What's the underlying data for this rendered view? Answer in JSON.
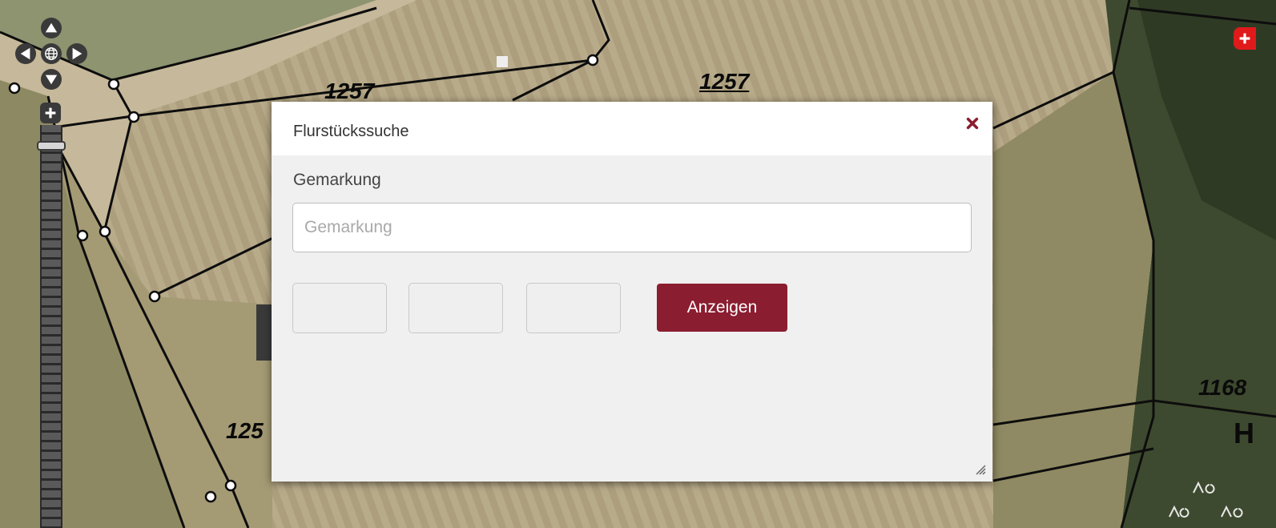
{
  "map": {
    "labels": [
      "1257",
      "1257",
      "125",
      "1168",
      "H"
    ]
  },
  "dialog": {
    "title": "Flurstückssuche",
    "field_label": "Gemarkung",
    "gemarkung_placeholder": "Gemarkung",
    "gemarkung_value": "",
    "inputs": [
      "",
      "",
      ""
    ],
    "submit_label": "Anzeigen"
  },
  "colors": {
    "accent": "#8b1d30",
    "close": "#8b1d30",
    "zoom_add": "#e01a1a"
  },
  "icons": {
    "close": "close-icon",
    "pan_up": "arrow-up-icon",
    "pan_down": "arrow-down-icon",
    "pan_left": "arrow-left-icon",
    "pan_right": "arrow-right-icon",
    "pan_center": "globe-icon",
    "zoom_in": "plus-icon",
    "resize": "resize-grip-icon"
  }
}
